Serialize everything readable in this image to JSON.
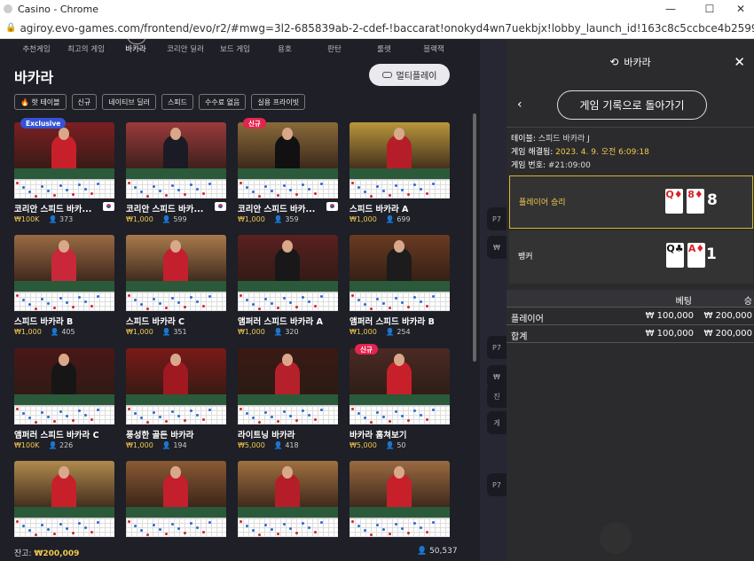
{
  "browser": {
    "title": "Casino - Chrome",
    "url": "agiroy.evo-games.com/frontend/evo/r2/#mwg=3l2-685839ab-2-cdef-!baccarat!onokyd4wn7uekbjx!lobby_launch_id!163c8c5ccbce4b25996e23311fe4b8bd!app!bacc..."
  },
  "nav": {
    "items": [
      "추천게임",
      "최고의 게임",
      "바카라",
      "코리안 딜러",
      "보드 게임",
      "용호",
      "판탄",
      "룰렛",
      "블랙잭"
    ],
    "active": "바카라"
  },
  "lobby": {
    "title": "바카라",
    "multiplay_label": "멀티플레이",
    "filters": [
      "🔥 핫 테이블",
      "신규",
      "네이티브 딜러",
      "스피드",
      "수수료 없음",
      "실용 프라이빗"
    ],
    "tables": [
      {
        "name": "코리안 스피드 바카...",
        "bet": "₩100K",
        "players": "373",
        "badge": "Exclusive",
        "flag": true,
        "bg": "#7b1f22",
        "person": "#c8202a"
      },
      {
        "name": "코리안 스피드 바카...",
        "bet": "₩1,000",
        "players": "599",
        "badge": "",
        "flag": true,
        "bg": "#9a3a3c",
        "person": "#1b1b25"
      },
      {
        "name": "코리안 스피드 바카...",
        "bet": "₩1,000",
        "players": "359",
        "badge": "신규",
        "flag": true,
        "bg": "#8a6a3a",
        "person": "#111"
      },
      {
        "name": "스피드 바카라 A",
        "bet": "₩1,000",
        "players": "699",
        "badge": "",
        "flag": false,
        "bg": "#b8963c",
        "person": "#b51e28"
      },
      {
        "name": "스피드 바카라 B",
        "bet": "₩1,000",
        "players": "405",
        "badge": "",
        "flag": false,
        "bg": "#9a6a44",
        "person": "#c9283a"
      },
      {
        "name": "스피드 바카라 C",
        "bet": "₩1,000",
        "players": "351",
        "badge": "",
        "flag": false,
        "bg": "#a87a4c",
        "person": "#c41f2c"
      },
      {
        "name": "앰퍼러 스피드 바카라 A",
        "bet": "₩1,000",
        "players": "320",
        "badge": "",
        "flag": false,
        "bg": "#5a2020",
        "person": "#181818"
      },
      {
        "name": "앰퍼러 스피드 바카라 B",
        "bet": "₩1,000",
        "players": "254",
        "badge": "",
        "flag": false,
        "bg": "#6a3a22",
        "person": "#1c1c1c"
      },
      {
        "name": "앰퍼러 스피드 바카라 C",
        "bet": "₩100K",
        "players": "226",
        "badge": "",
        "flag": false,
        "bg": "#4a1818",
        "person": "#161616"
      },
      {
        "name": "풍성한 골든 바카라",
        "bet": "₩1,000",
        "players": "194",
        "badge": "",
        "flag": false,
        "bg": "#7a1a18",
        "person": "#a01820"
      },
      {
        "name": "라이트닝 바카라",
        "bet": "₩5,000",
        "players": "418",
        "badge": "",
        "flag": false,
        "bg": "#3a1a14",
        "person": "#b5202a"
      },
      {
        "name": "바카라 훔쳐보기",
        "bet": "₩5,000",
        "players": "50",
        "badge": "신규",
        "flag": false,
        "bg": "#4a2a24",
        "person": "#c8202a"
      },
      {
        "name": "",
        "bet": "",
        "players": "",
        "badge": "",
        "flag": false,
        "bg": "#b08a4c",
        "person": "#c8202a"
      },
      {
        "name": "",
        "bet": "",
        "players": "",
        "badge": "",
        "flag": false,
        "bg": "#8a5a34",
        "person": "#c41f2c"
      },
      {
        "name": "",
        "bet": "",
        "players": "",
        "badge": "",
        "flag": false,
        "bg": "#a07040",
        "person": "#b51e28"
      },
      {
        "name": "",
        "bet": "",
        "players": "",
        "badge": "",
        "flag": false,
        "bg": "#9a6a40",
        "person": "#c8202a"
      }
    ],
    "balance_label": "잔고:",
    "balance_value": "₩200,009",
    "online_count": "50,537"
  },
  "mid_strip": {
    "labels": [
      "P7",
      "₩",
      "P7",
      "₩",
      "진",
      "게",
      "P7"
    ]
  },
  "panel": {
    "title": "바카라",
    "back_label": "게임 기록으로 돌아가기",
    "table_label": "테이블:",
    "table_value": "스피드 바카라 J",
    "resolved_label": "게임 해결됨:",
    "resolved_value": "2023. 4. 9. 오전 6:09:18",
    "game_no_label": "게임 번호:",
    "game_no_value": "#21:09:00",
    "player": {
      "label": "플레이어 승리",
      "cards": [
        "Q♦",
        "8♦"
      ],
      "score": "8"
    },
    "banker": {
      "label": "뱅커",
      "cards": [
        "Q♣",
        "A♦"
      ],
      "score": "1"
    },
    "bets_header": {
      "bet": "베팅",
      "win": "승"
    },
    "rows": [
      {
        "name": "플레이어",
        "bet": "₩ 100,000",
        "win": "₩ 200,000"
      },
      {
        "name": "합계",
        "bet": "₩ 100,000",
        "win": "₩ 200,000"
      }
    ]
  },
  "colors": {
    "accent_gold": "#f2c94c",
    "badge_new": "#e3244f",
    "badge_exclusive": "#3553d6"
  }
}
